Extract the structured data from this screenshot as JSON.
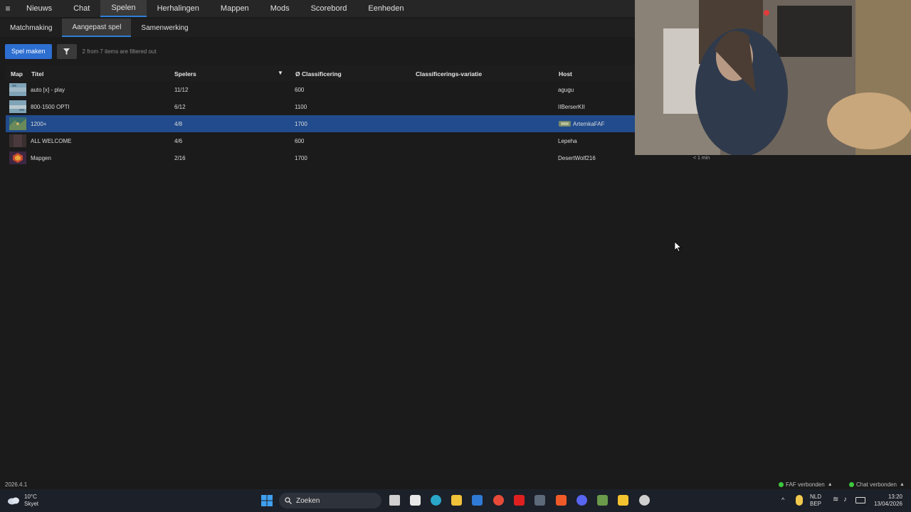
{
  "nav": {
    "tabs": [
      "Nieuws",
      "Chat",
      "Spelen",
      "Herhalingen",
      "Mappen",
      "Mods",
      "Scorebord",
      "Eenheden"
    ],
    "active_tab": "Spelen"
  },
  "subnav": {
    "tabs": [
      "Matchmaking",
      "Aangepast spel",
      "Samenwerking"
    ],
    "active_tab": "Aangepast spel"
  },
  "toolbar": {
    "create_game_label": "Spel maken",
    "filter_status": "2 from 7 items are filtered out"
  },
  "table": {
    "headers": {
      "map": "Map",
      "title": "Titel",
      "players": "Spelers",
      "rating": "Ø Classificering",
      "rating_variation": "Classificerings-variatie",
      "host": "Host"
    },
    "rows": [
      {
        "title": "auto [x] - play",
        "players": "11/12",
        "rating": "600",
        "host": "agugu",
        "selected": false
      },
      {
        "title": "800-1500 OPTI",
        "players": "6/12",
        "rating": "1100",
        "host": "IIBerserKII",
        "selected": false
      },
      {
        "title": "1200+",
        "players": "4/8",
        "rating": "1700",
        "host": "ArtemkaFAF",
        "selected": true
      },
      {
        "title": "ALL WELCOME",
        "players": "4/6",
        "rating": "600",
        "host": "Lepeha",
        "selected": false
      },
      {
        "title": "Mapgen",
        "players": "2/16",
        "rating": "1700",
        "host": "DesertWolf216",
        "selected": false
      }
    ]
  },
  "time_ago": "< 1 min",
  "statusbar": {
    "version": "2026.4.1",
    "faf_status": "FAF verbonden",
    "chat_status": "Chat verbonden"
  },
  "taskbar": {
    "weather_temp": "10°C",
    "weather_desc": "Skyet",
    "search_label": "Zoeken",
    "lang_top": "NLD",
    "lang_bottom": "BEP",
    "time": "13:20",
    "date": "13/04/2026"
  },
  "colors": {
    "accent": "#2f7fd6",
    "selected_row": "#214b8c",
    "primary_button": "#2d6ed1",
    "status_ok": "#3cc83c"
  }
}
